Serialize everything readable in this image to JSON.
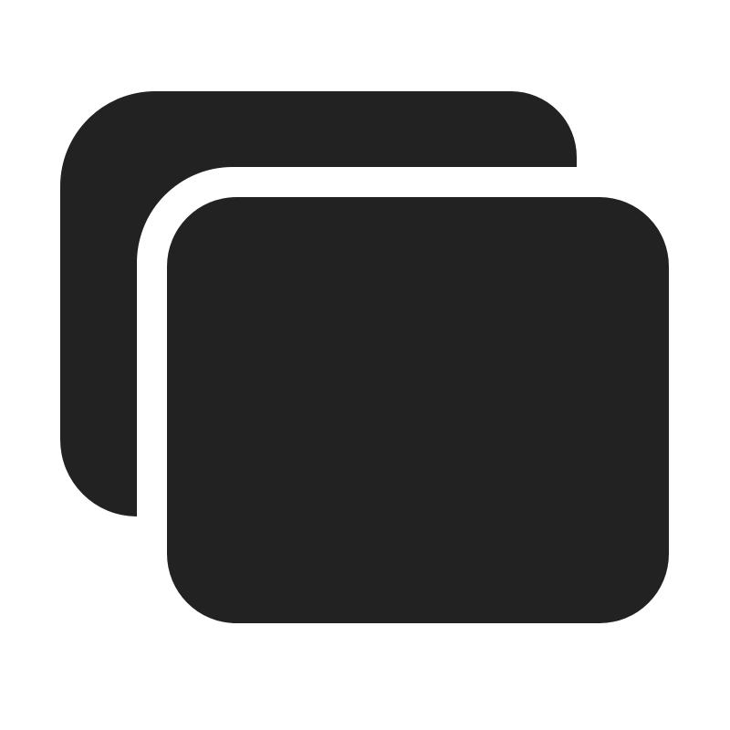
{
  "icon": {
    "name": "window-stack-icon",
    "color": "#222222",
    "background": "#ffffff"
  }
}
